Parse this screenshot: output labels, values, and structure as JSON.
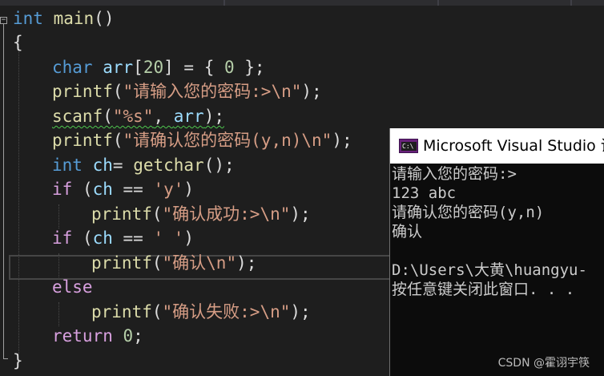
{
  "editor": {
    "lines": [
      [
        "int",
        " ",
        "main",
        "()"
      ],
      [
        "{"
      ],
      [
        "char",
        " ",
        "arr",
        "[",
        "20",
        "] = { ",
        "0",
        " };"
      ],
      [
        "printf",
        "(",
        "\"请输入您的密码:>\\n\"",
        ");"
      ],
      [
        "scanf",
        "(",
        "\"%s\"",
        ", ",
        "arr",
        ");"
      ],
      [
        "printf",
        "(",
        "\"请确认您的密码(y,n)\\n\"",
        ");"
      ],
      [
        "int",
        " ",
        "ch",
        "= ",
        "getchar",
        "();"
      ],
      [
        "if",
        " (",
        "ch",
        " == ",
        "'y'",
        ")"
      ],
      [
        "printf",
        "(",
        "\"确认成功:>\\n\"",
        ");"
      ],
      [
        "if",
        " (",
        "ch",
        " == ",
        "' '",
        ")"
      ],
      [
        "printf",
        "(",
        "\"确认\\n\"",
        ");"
      ],
      [
        "else"
      ],
      [
        "printf",
        "(",
        "\"确认失败:>\\n\"",
        ");"
      ],
      [
        "return",
        " ",
        "0",
        ";"
      ],
      [
        "}"
      ]
    ]
  },
  "console": {
    "title": "Microsoft Visual Studio 调试控制台",
    "icon_label": "C:\\",
    "lines": [
      "请输入您的密码:>",
      "123 abc",
      "请确认您的密码(y,n)",
      "确认",
      "",
      "D:\\Users\\大黄\\huangyu-",
      "按任意键关闭此窗口. . ."
    ]
  },
  "watermark": "CSDN @霍诩宇筷",
  "colors": {
    "background": "#1e1e1e",
    "keyword": "#569cd6",
    "function": "#dcdcaa",
    "string": "#d69d85",
    "number": "#b5cea8",
    "variable": "#9cdcfe",
    "control": "#d8a0df",
    "squiggle": "#4ec94e",
    "console_bg": "#0c0c0c"
  }
}
